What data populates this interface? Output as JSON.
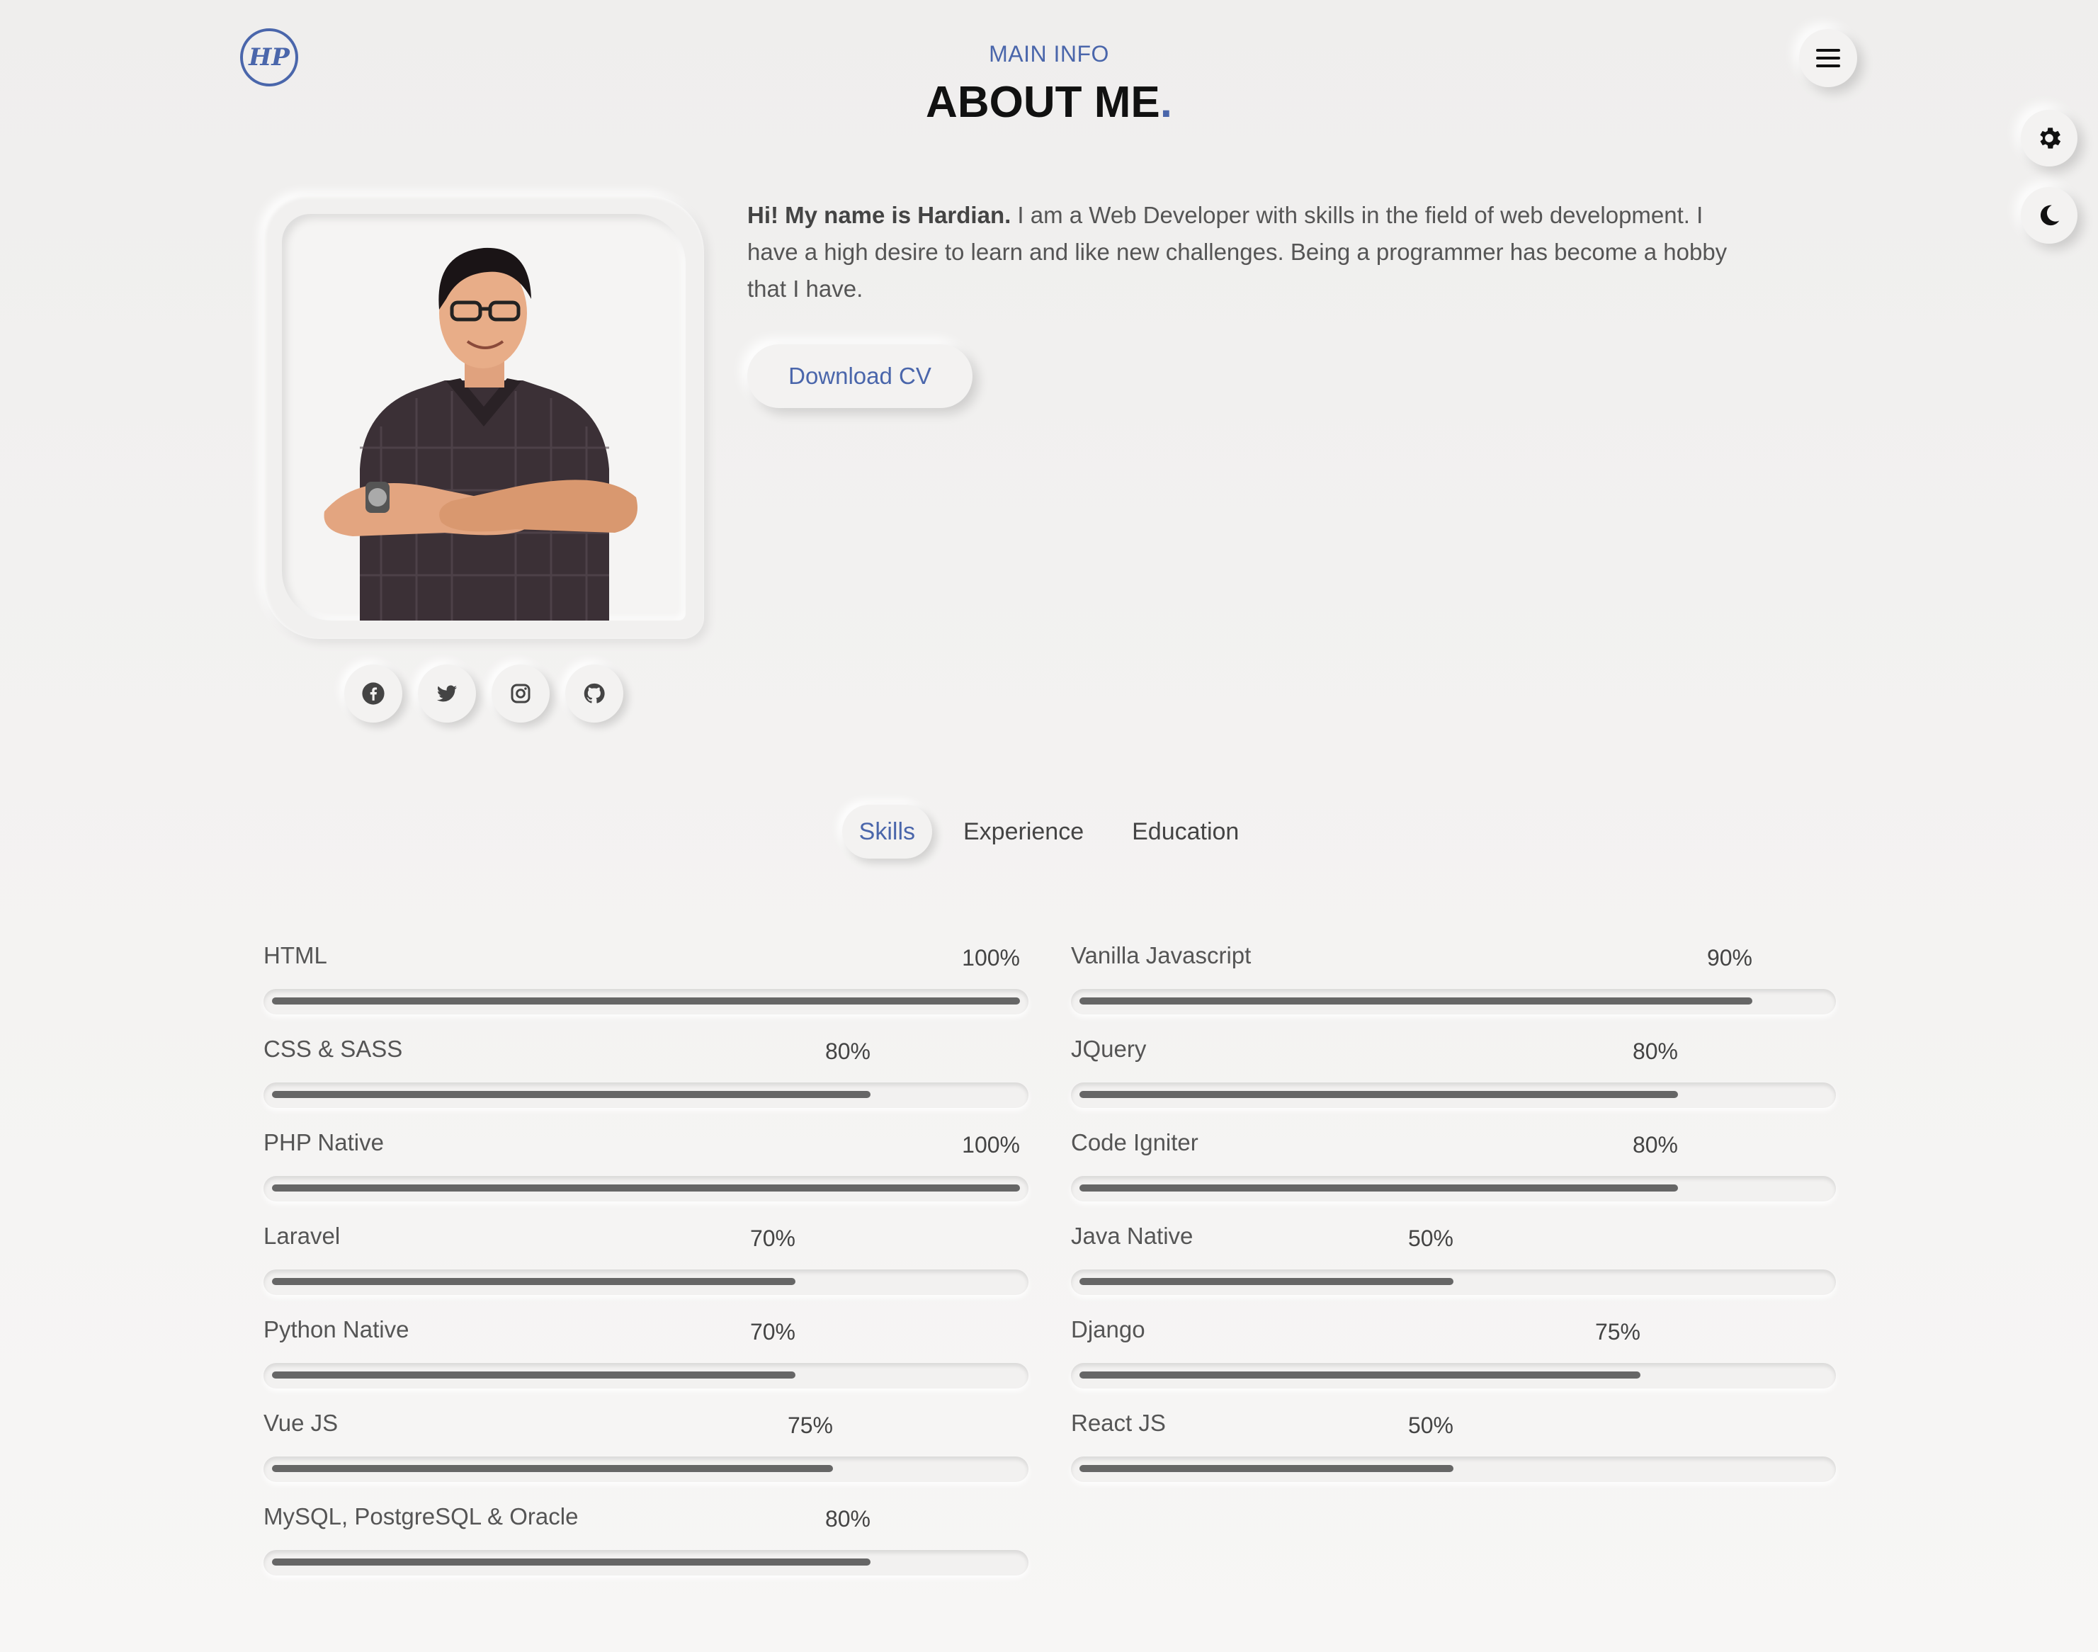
{
  "logo": {
    "text": "HP"
  },
  "header": {
    "subtitle": "MAIN INFO",
    "title": "ABOUT ME",
    "title_dot": "."
  },
  "intro": {
    "greeting": "Hi! My name is Hardian.",
    "text": " I am a Web Developer with skills in the field of web development. I have a high desire to learn and like new challenges. Being a programmer has become a hobby that I have."
  },
  "download_label": "Download CV",
  "socials": [
    "facebook-icon",
    "twitter-icon",
    "instagram-icon",
    "github-icon"
  ],
  "tabs": [
    {
      "label": "Skills",
      "active": true
    },
    {
      "label": "Experience",
      "active": false
    },
    {
      "label": "Education",
      "active": false
    }
  ],
  "skills_left": [
    {
      "name": "HTML",
      "percent": "100%",
      "value": 100
    },
    {
      "name": "CSS & SASS",
      "percent": "80%",
      "value": 80
    },
    {
      "name": "PHP Native",
      "percent": "100%",
      "value": 100
    },
    {
      "name": "Laravel",
      "percent": "70%",
      "value": 70
    },
    {
      "name": "Python Native",
      "percent": "70%",
      "value": 70
    },
    {
      "name": "Vue JS",
      "percent": "75%",
      "value": 75
    },
    {
      "name": "MySQL, PostgreSQL & Oracle",
      "percent": "80%",
      "value": 80
    }
  ],
  "skills_right": [
    {
      "name": "Vanilla Javascript",
      "percent": "90%",
      "value": 90
    },
    {
      "name": "JQuery",
      "percent": "80%",
      "value": 80
    },
    {
      "name": "Code Igniter",
      "percent": "80%",
      "value": 80
    },
    {
      "name": "Java Native",
      "percent": "50%",
      "value": 50
    },
    {
      "name": "Django",
      "percent": "75%",
      "value": 75
    },
    {
      "name": "React JS",
      "percent": "50%",
      "value": 50
    }
  ],
  "colors": {
    "accent": "#4a66ab",
    "bar": "#666666",
    "background": "#f3f2f1"
  }
}
